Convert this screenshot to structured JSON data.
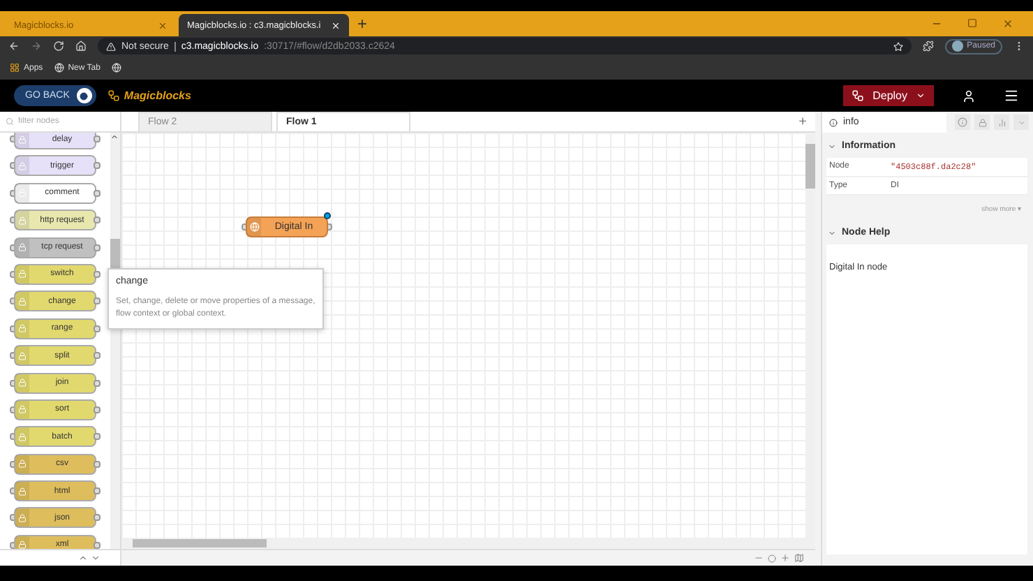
{
  "browser": {
    "tabs": [
      {
        "title": "Magicblocks.io",
        "selected": false
      },
      {
        "title": "Magicblocks.io : c3.magicblocks.i",
        "selected": true
      }
    ],
    "new_tab": "+",
    "address": {
      "security": "Not secure",
      "host": "c3.magicblocks.io",
      "path": ":30717/#flow/d2db2033.c2624"
    },
    "bookmarks": [
      "Apps",
      "New Tab"
    ],
    "profile": "Paused"
  },
  "header": {
    "back_button": "GO BACK",
    "logo": "Magicblocks",
    "deploy": "Deploy"
  },
  "palette": {
    "filter": {
      "placeholder": "filter nodes"
    },
    "nodes": [
      {
        "label": "delay",
        "color": "#e6e0f8"
      },
      {
        "label": "trigger",
        "color": "#e6e0f8"
      },
      {
        "label": "comment",
        "color": "#ffffff"
      },
      {
        "label": "http request",
        "color": "#e7e7ae"
      },
      {
        "label": "tcp request",
        "color": "#c0c0c0"
      },
      {
        "label": "switch",
        "color": "#e2d96e"
      },
      {
        "label": "change",
        "color": "#e2d96e"
      },
      {
        "label": "range",
        "color": "#e2d96e"
      },
      {
        "label": "split",
        "color": "#e2d96e"
      },
      {
        "label": "join",
        "color": "#e2d96e"
      },
      {
        "label": "sort",
        "color": "#e2d96e"
      },
      {
        "label": "batch",
        "color": "#e2d96e"
      },
      {
        "label": "csv",
        "color": "#debd5c"
      },
      {
        "label": "html",
        "color": "#debd5c"
      },
      {
        "label": "json",
        "color": "#debd5c"
      },
      {
        "label": "xml",
        "color": "#debd5c"
      }
    ]
  },
  "workspace": {
    "tabs": [
      {
        "label": "Flow 2",
        "selected": false
      },
      {
        "label": "Flow 1",
        "selected": true
      }
    ],
    "add_tab": "+",
    "nodes": [
      {
        "label": "Digital In",
        "changed": true
      }
    ],
    "tooltip": {
      "title": "change",
      "text": "Set, change, delete or move properties of a message, flow context or global context."
    }
  },
  "sidebar": {
    "tab": "info",
    "sections": [
      {
        "title": "Information",
        "rows": [
          {
            "label": "Node",
            "value": "\"4503c88f.da2c28\""
          },
          {
            "label": "Type",
            "value": "DI"
          }
        ],
        "show_more": "show more ▾"
      },
      {
        "title": "Node Help",
        "text": "Digital In node"
      }
    ]
  }
}
